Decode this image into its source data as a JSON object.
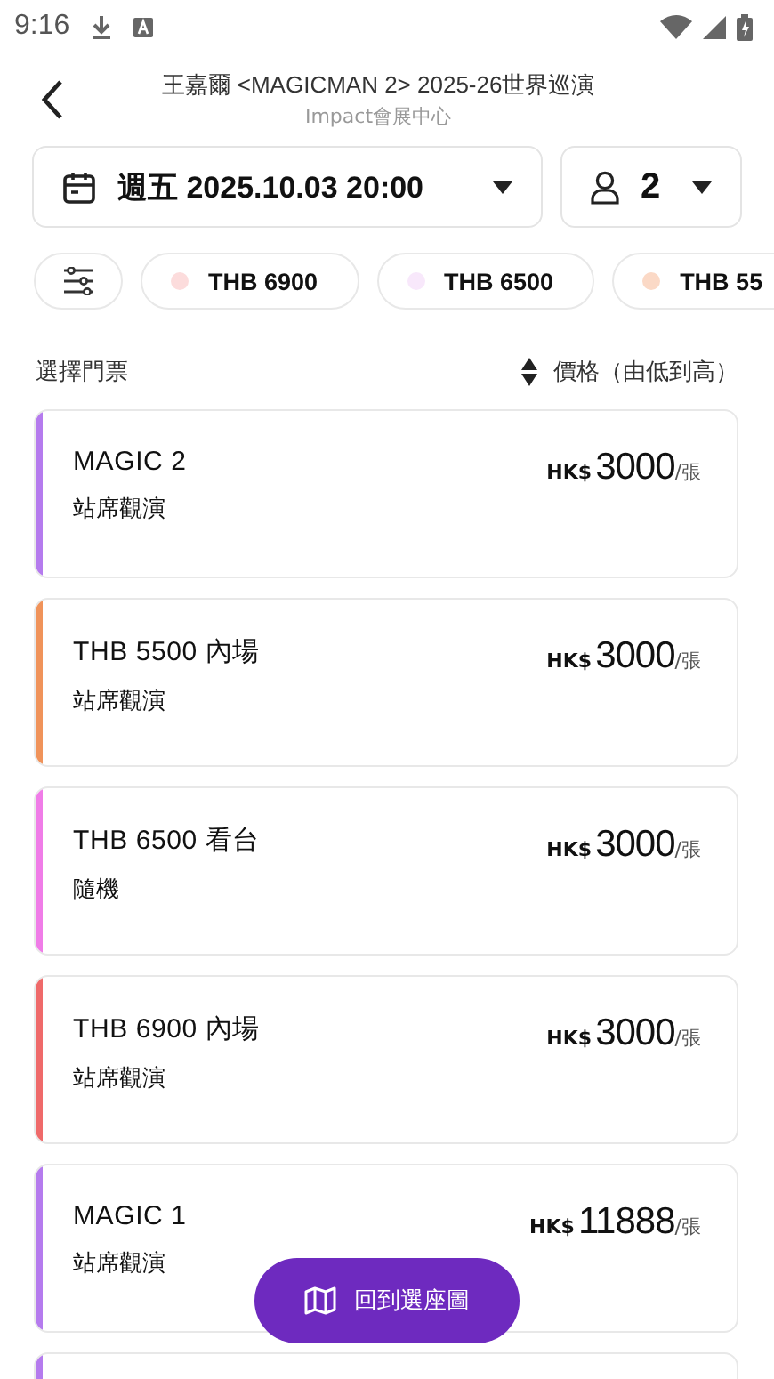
{
  "status_bar": {
    "time": "9:16"
  },
  "header": {
    "title": "王嘉爾  <MAGICMAN 2>  2025-26世界巡演",
    "subtitle": "Impact會展中心"
  },
  "date_select": {
    "value": "週五 2025.10.03 20:00"
  },
  "qty_select": {
    "value": "2"
  },
  "chips": [
    {
      "label": "THB 6900",
      "color": "#fcdcdc"
    },
    {
      "label": "THB 6500",
      "color": "#f8e8fb"
    },
    {
      "label": "THB 55",
      "color": "#fbd9c6"
    }
  ],
  "list_header": {
    "title": "選擇門票",
    "sort": "價格（由低到高）"
  },
  "tickets": [
    {
      "name": "MAGIC 2",
      "type": "站席觀演",
      "currency": "HK$",
      "price": "3000",
      "unit": "/張",
      "color": "#b57bee"
    },
    {
      "name": "THB 5500 內場",
      "type": "站席觀演",
      "currency": "HK$",
      "price": "3000",
      "unit": "/張",
      "color": "#f0935a"
    },
    {
      "name": "THB 6500 看台",
      "type": "隨機",
      "currency": "HK$",
      "price": "3000",
      "unit": "/張",
      "color": "#f07ce8"
    },
    {
      "name": "THB 6900 內場",
      "type": "站席觀演",
      "currency": "HK$",
      "price": "3000",
      "unit": "/張",
      "color": "#ef6a6a"
    },
    {
      "name": "MAGIC 1",
      "type": "站席觀演",
      "currency": "HK$",
      "price": "11888",
      "unit": "/張",
      "color": "#b57bee"
    },
    {
      "color": "#b57bee"
    }
  ],
  "fab": {
    "label": "回到選座圖"
  }
}
